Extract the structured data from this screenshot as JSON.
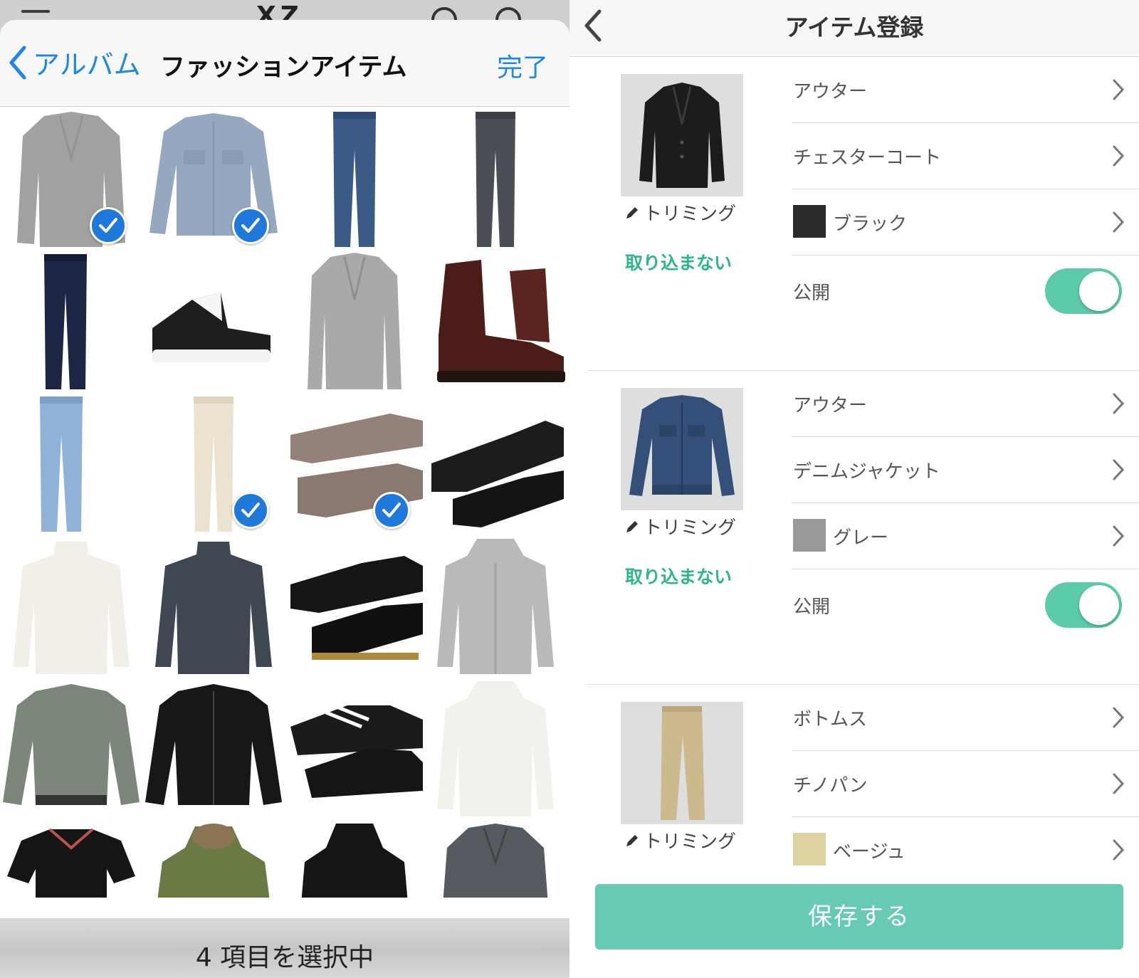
{
  "album_picker": {
    "back_label": "アルバム",
    "title": "ファッションアイテム",
    "done_label": "完了",
    "selection_status": "4 項目を選択中",
    "items": [
      {
        "name": "grey-chester-coat",
        "selected": true
      },
      {
        "name": "denim-jacket",
        "selected": true
      },
      {
        "name": "blue-jeans",
        "selected": false
      },
      {
        "name": "black-jeans",
        "selected": false
      },
      {
        "name": "navy-jeans",
        "selected": false
      },
      {
        "name": "converse-sneakers",
        "selected": false
      },
      {
        "name": "light-grey-coat",
        "selected": false
      },
      {
        "name": "burgundy-boots",
        "selected": false
      },
      {
        "name": "light-wash-jeans",
        "selected": false
      },
      {
        "name": "beige-chinos",
        "selected": true
      },
      {
        "name": "brown-loafers",
        "selected": true
      },
      {
        "name": "black-suede-shoes",
        "selected": false
      },
      {
        "name": "white-turtleneck",
        "selected": false
      },
      {
        "name": "charcoal-turtleneck",
        "selected": false
      },
      {
        "name": "black-derby-shoes",
        "selected": false
      },
      {
        "name": "grey-hoodie",
        "selected": false
      },
      {
        "name": "khaki-bomber",
        "selected": false
      },
      {
        "name": "black-bomber",
        "selected": false
      },
      {
        "name": "black-running-shoes",
        "selected": false
      },
      {
        "name": "white-hoodie",
        "selected": false
      },
      {
        "name": "black-polo",
        "selected": false
      },
      {
        "name": "olive-parka",
        "selected": false
      },
      {
        "name": "black-hoodie",
        "selected": false
      },
      {
        "name": "grey-pea-coat",
        "selected": false
      }
    ]
  },
  "registration": {
    "title": "アイテム登録",
    "items": [
      {
        "thumb": "black-chester-coat",
        "trim_label": "トリミング",
        "skip_label": "取り込まない",
        "category": "アウター",
        "subcategory": "チェスターコート",
        "color_name": "ブラック",
        "color_hex": "#2a2a2a",
        "public_label": "公開",
        "public_on": true
      },
      {
        "thumb": "denim-jacket",
        "trim_label": "トリミング",
        "skip_label": "取り込まない",
        "category": "アウター",
        "subcategory": "デニムジャケット",
        "color_name": "グレー",
        "color_hex": "#9a9a9a",
        "public_label": "公開",
        "public_on": true
      },
      {
        "thumb": "beige-chinos",
        "trim_label": "トリミング",
        "category": "ボトムス",
        "subcategory": "チノパン",
        "color_name": "ベージュ",
        "color_hex": "#ddd2a2"
      }
    ],
    "save_label": "保存する"
  },
  "colors": {
    "ios_blue": "#1e86e8",
    "accent_green": "#2cb58e",
    "toggle_green": "#5ccbac",
    "save_green": "#66cbb2"
  }
}
